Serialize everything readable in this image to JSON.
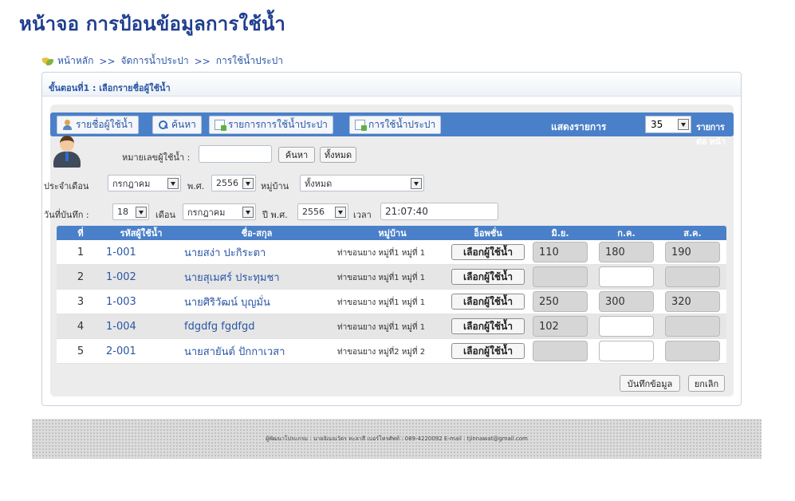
{
  "page_title": "หน้าจอ การป้อนข้อมูลการใช้น้ำ",
  "breadcrumb": {
    "home": "หน้าหลัก",
    "sep": ">>",
    "manage": "จัดการน้ำประปา",
    "current": "การใช้น้ำประปา"
  },
  "step_header": "ขั้นตอนที่1 : เลือกรายชื่อผู้ใช้น้ำ",
  "toolbar": {
    "users_list": "รายชื่อผู้ใช้น้ำ",
    "search": "ค้นหา",
    "usage_list": "รายการการใช้น้ำประปา",
    "usage": "การใช้น้ำประปา",
    "show_label": "แสดงรายการ",
    "per_page_value": "35",
    "per_page_suffix": "รายการ ต่อ หน้า"
  },
  "search_form": {
    "user_no_label": "หมายเลขผู้ใช้น้ำ :",
    "user_no_value": "",
    "search_button": "ค้นหา",
    "all_button": "ทั้งหมด"
  },
  "period": {
    "month_label": "ประจำเดือน",
    "month_value": "กรกฎาคม",
    "year_label": "พ.ศ.",
    "year_value": "2556",
    "village_label": "หมู่บ้าน",
    "village_value": "ทั้งหมด"
  },
  "record_date": {
    "label": "วันที่บันทึก :",
    "day_value": "18",
    "month_label": "เดือน",
    "month_value": "กรกฎาคม",
    "year_label": "ปี พ.ศ.",
    "year_value": "2556",
    "time_label": "เวลา",
    "time_value": "21:07:40"
  },
  "table": {
    "headers": [
      "ที่",
      "รหัสผู้ใช้น้ำ",
      "ชื่อ-สกุล",
      "หมู่บ้าน",
      "อ็อพชั่น",
      "มิ.ย.",
      "ก.ค.",
      "ส.ค."
    ],
    "action_label": "เลือกผู้ใช้น้ำ",
    "rows": [
      {
        "no": "1",
        "code": "1-001",
        "name": "นายสง่า ปะกิระตา",
        "village": "ท่าขอนยาง หมู่ที่1 หมู่ที่ 1",
        "jun": "110",
        "jul": "180",
        "aug": "190"
      },
      {
        "no": "2",
        "code": "1-002",
        "name": "นายสุเมศร์ ประทุมชา",
        "village": "ท่าขอนยาง หมู่ที่1 หมู่ที่ 1",
        "jun": "",
        "jul": "",
        "aug": ""
      },
      {
        "no": "3",
        "code": "1-003",
        "name": "นายศิริวัฒน์ บุญมั่น",
        "village": "ท่าขอนยาง หมู่ที่1 หมู่ที่ 1",
        "jun": "250",
        "jul": "300",
        "aug": "320"
      },
      {
        "no": "4",
        "code": "1-004",
        "name": "fdgdfg fgdfgd",
        "village": "ท่าขอนยาง หมู่ที่1 หมู่ที่ 1",
        "jun": "102",
        "jul": "",
        "aug": ""
      },
      {
        "no": "5",
        "code": "2-001",
        "name": "นายสายันต์ ปักกาเวสา",
        "village": "ท่าขอนยาง หมู่ที่2 หมู่ที่ 2",
        "jun": "",
        "jul": "",
        "aug": ""
      }
    ]
  },
  "actions": {
    "save": "บันทึกข้อมูล",
    "cancel": "ยกเลิก"
  },
  "footer": "ผู้พัฒนาโปรแกรม : นายจิณณวัตร ทะลาสี เบอร์โทรศัพท์ : 089-4220092 E-mail : tjinnawat@gmail.com"
}
